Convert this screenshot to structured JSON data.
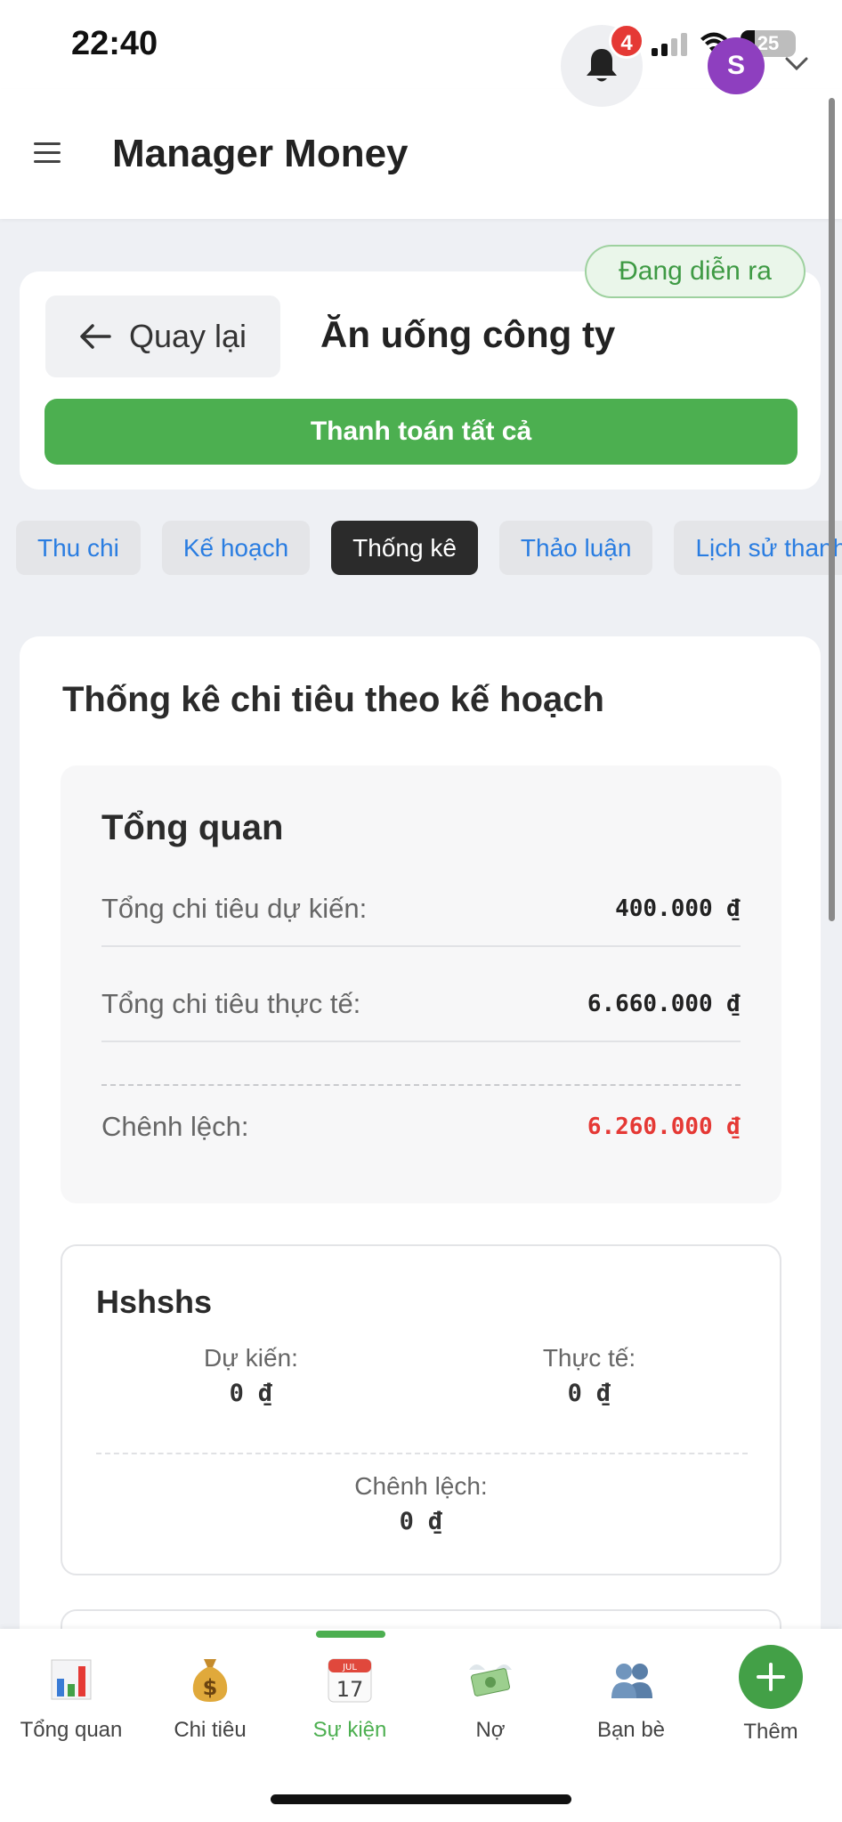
{
  "status_bar": {
    "time": "22:40",
    "battery": "25"
  },
  "header": {
    "title": "Manager Money",
    "notification_count": "4",
    "avatar_initial": "S"
  },
  "event": {
    "status": "Đang diễn ra",
    "back_label": "Quay lại",
    "title": "Ăn uống công ty",
    "pay_all_label": "Thanh toán tất cả"
  },
  "tabs": [
    {
      "label": "Thu chi",
      "active": false
    },
    {
      "label": "Kế hoạch",
      "active": false
    },
    {
      "label": "Thống kê",
      "active": true
    },
    {
      "label": "Thảo luận",
      "active": false
    },
    {
      "label": "Lịch sử thanh",
      "active": false
    }
  ],
  "stats": {
    "title": "Thống kê chi tiêu theo kế hoạch",
    "overview": {
      "title": "Tổng quan",
      "planned_label": "Tổng chi tiêu dự kiến:",
      "planned_value": "400.000 ₫",
      "actual_label": "Tổng chi tiêu thực tế:",
      "actual_value": "6.660.000 ₫",
      "diff_label": "Chênh lệch:",
      "diff_value": "6.260.000 ₫"
    },
    "items": [
      {
        "name": "Hshshs",
        "planned_label": "Dự kiến:",
        "planned_value": "0 ₫",
        "actual_label": "Thực tế:",
        "actual_value": "0 ₫",
        "diff_label": "Chênh lệch:",
        "diff_value": "0 ₫"
      }
    ]
  },
  "bottom_nav": [
    {
      "label": "Tổng quan",
      "icon": "bar-chart-icon"
    },
    {
      "label": "Chi tiêu",
      "icon": "money-bag-icon"
    },
    {
      "label": "Sự kiện",
      "icon": "calendar-icon",
      "active": true,
      "calendar_month": "JUL",
      "calendar_day": "17"
    },
    {
      "label": "Nợ",
      "icon": "money-wings-icon"
    },
    {
      "label": "Bạn bè",
      "icon": "people-icon"
    },
    {
      "label": "Thêm",
      "icon": "plus-icon"
    }
  ],
  "colors": {
    "accent_green": "#4caf50",
    "danger_red": "#e53935",
    "link_blue": "#2a7de1",
    "avatar_purple": "#8e3fbf"
  }
}
